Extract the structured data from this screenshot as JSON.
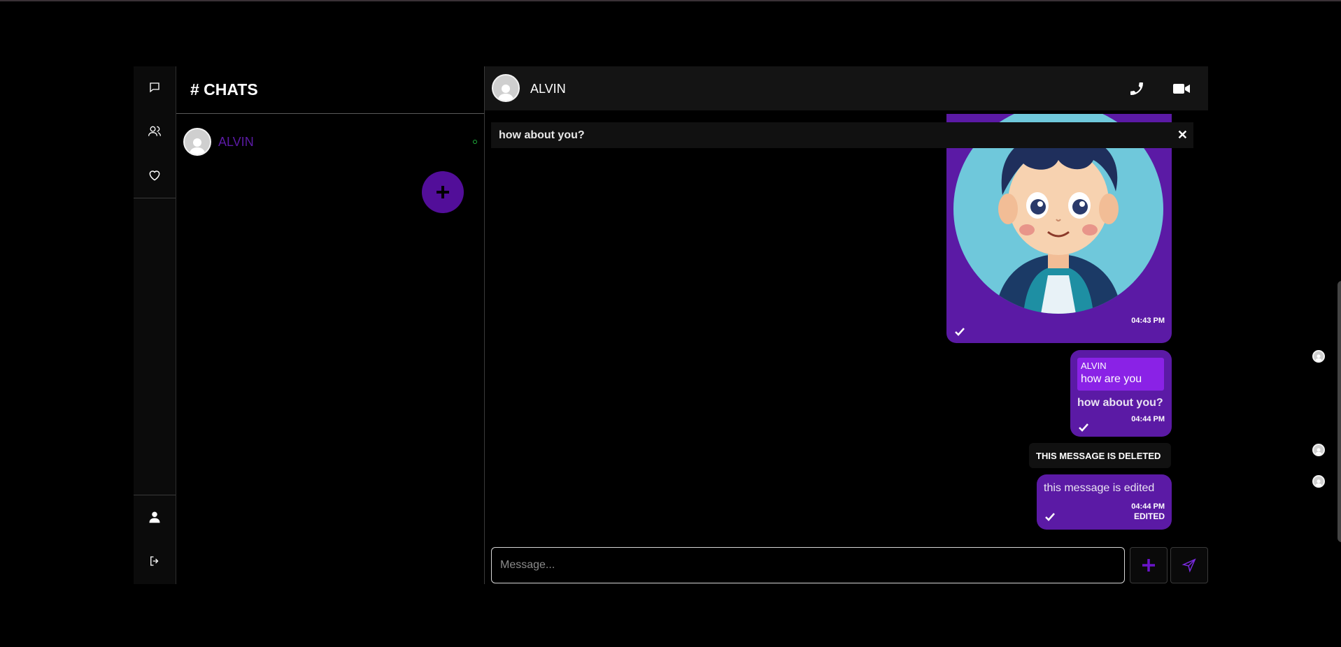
{
  "sidebar": {
    "icons": [
      "chat-bubble-icon",
      "users-icon",
      "heart-icon",
      "user-icon",
      "logout-icon"
    ]
  },
  "chats_panel": {
    "title": "# CHATS",
    "items": [
      {
        "name": "ALVIN",
        "status": "online"
      }
    ],
    "add_label": "+"
  },
  "chat": {
    "contact_name": "ALVIN",
    "reply_preview": {
      "text": "how about you?",
      "close": "✕"
    },
    "messages": [
      {
        "type": "image",
        "time": "04:43 PM"
      },
      {
        "type": "reply",
        "quoted_name": "ALVIN",
        "quoted_text": "how are you",
        "text": "how about you?",
        "time": "04:44 PM"
      },
      {
        "type": "deleted",
        "text": "THIS MESSAGE IS DELETED"
      },
      {
        "type": "edited",
        "text": "this message is edited",
        "time": "04:44 PM",
        "edited_label": "EDITED"
      }
    ],
    "composer": {
      "placeholder": "Message...",
      "value": ""
    }
  },
  "colors": {
    "accent": "#5b1aa5",
    "fab": "#520e99",
    "quote": "#8a22e6",
    "online": "#1fae3b"
  }
}
